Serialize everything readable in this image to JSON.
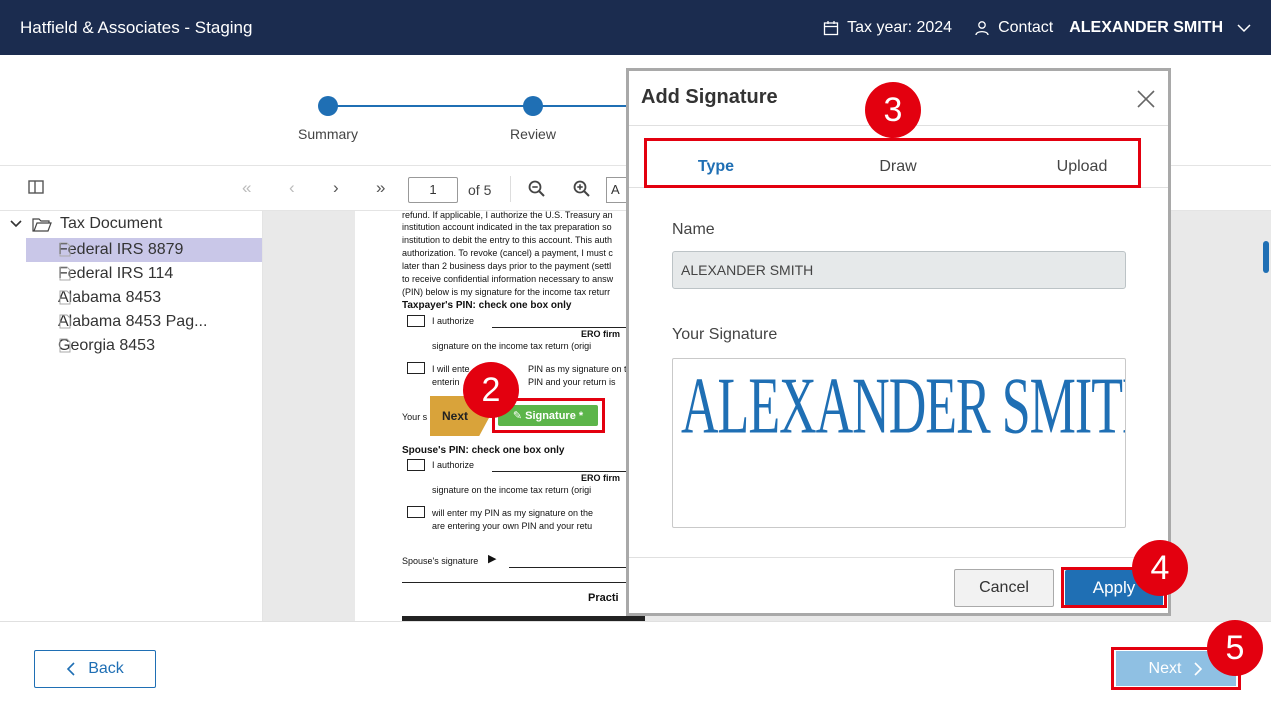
{
  "header": {
    "title": "Hatfield & Associates - Staging",
    "tax_year": "Tax year: 2024",
    "contact": "Contact",
    "user": "ALEXANDER SMITH"
  },
  "stepper": {
    "steps": [
      {
        "label": "Summary"
      },
      {
        "label": "Review"
      }
    ]
  },
  "toolbar": {
    "page_value": "1",
    "page_of": "of 5",
    "zoom_value": "A"
  },
  "sidebar": {
    "root_label": "Tax Document",
    "items": [
      {
        "label": "Federal IRS 8879",
        "selected": true
      },
      {
        "label": "Federal IRS 114",
        "selected": false
      },
      {
        "label": "Alabama 8453",
        "selected": false
      },
      {
        "label": "Alabama 8453 Pag...",
        "selected": false
      },
      {
        "label": "Georgia 8453",
        "selected": false
      }
    ]
  },
  "document": {
    "lines": [
      "refund. If applicable, I authorize the U.S. Treasury an",
      "institution account indicated in the tax preparation so",
      "institution to debit the entry to this account. This auth",
      "authorization. To revoke (cancel) a payment, I must c",
      "later than 2 business days prior to the payment (settl",
      "to receive confidential information necessary to answ",
      "(PIN) below is my signature for the income tax returr"
    ],
    "taxpayer_pin_heading": "Taxpayer's PIN: check one box only",
    "i_authorize": "I authorize",
    "ero_firm": "ERO firm",
    "signature_on_return": "signature on the income tax return (origi",
    "will_enter_1": "I will ente",
    "will_enter_1b": "PIN as my signature on the",
    "entering_1": "enterin",
    "entering_1b": "PIN and your return is",
    "your_sig": "Your s",
    "spouse_pin_heading": "Spouse's PIN: check one box only",
    "will_enter_2": "will enter my PIN as my signature on the",
    "entering_2": "are entering your own PIN and your retu",
    "spouse_signature": "Spouse's signature",
    "practi": "Practi",
    "next_tag": "Next",
    "signature_button": "✎ Signature *"
  },
  "modal": {
    "title": "Add Signature",
    "tabs": [
      "Type",
      "Draw",
      "Upload"
    ],
    "active_tab": "Type",
    "name_label": "Name",
    "name_value": "ALEXANDER SMITH",
    "signature_label": "Your Signature",
    "signature_preview": "ALEXANDER SMITH",
    "cancel": "Cancel",
    "apply": "Apply"
  },
  "footer": {
    "back": "Back",
    "next": "Next"
  },
  "callouts": [
    "2",
    "3",
    "4",
    "5"
  ],
  "colors": {
    "header_bg": "#1b2c4f",
    "accent": "#1f6fb4",
    "callout_red": "#e3000f",
    "signature_green": "#5cb54a",
    "next_tag_gold": "#d9a33a"
  }
}
